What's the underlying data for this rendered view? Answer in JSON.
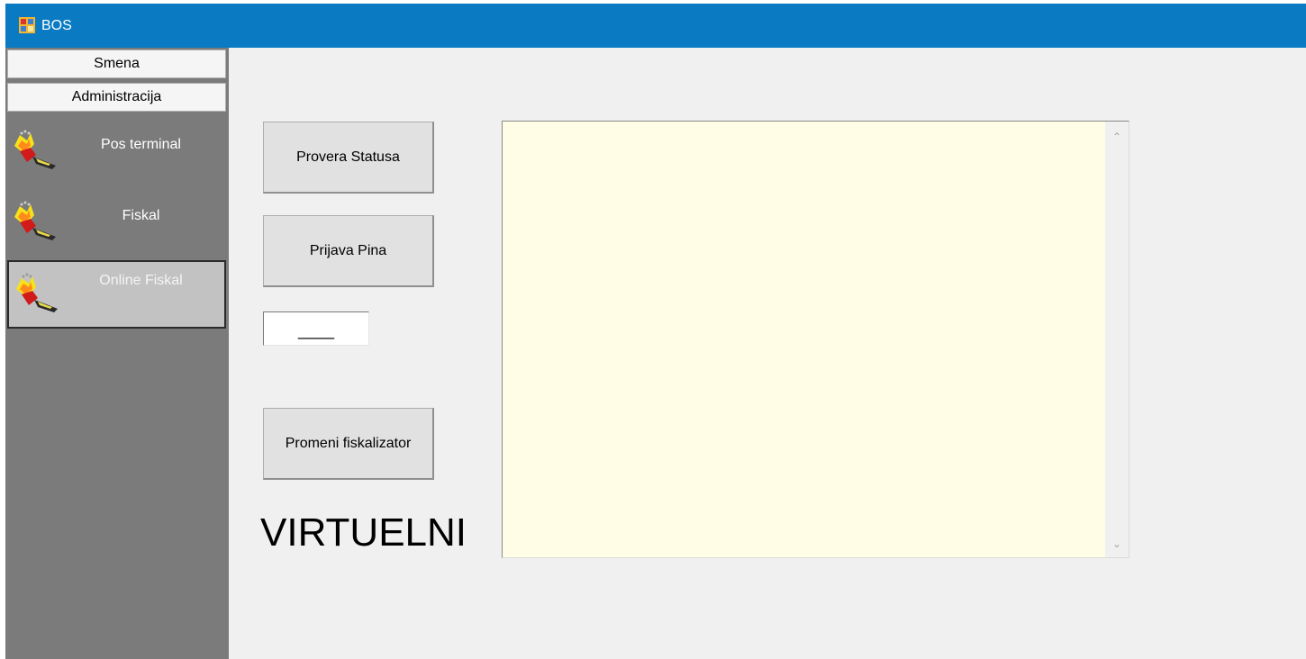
{
  "window": {
    "title": "BOS",
    "titlebar_color": "#0a7bc2"
  },
  "sidebar": {
    "groups": [
      {
        "label": "Smena"
      },
      {
        "label": "Administracija"
      }
    ],
    "items": [
      {
        "label": "Pos terminal",
        "icon": "plug-icon",
        "selected": false
      },
      {
        "label": "Fiskal",
        "icon": "plug-icon",
        "selected": false
      },
      {
        "label": "Online Fiskal",
        "icon": "plug-icon",
        "selected": true
      }
    ]
  },
  "main": {
    "buttons": {
      "status": "Provera Statusa",
      "pin": "Prijava Pina",
      "change_fiscalizer": "Promeni fiskalizator"
    },
    "pin_field": {
      "value": "____"
    },
    "fiscalizer_label": "VIRTUELNI",
    "log": {
      "value": "",
      "background": "#fffde6"
    }
  }
}
